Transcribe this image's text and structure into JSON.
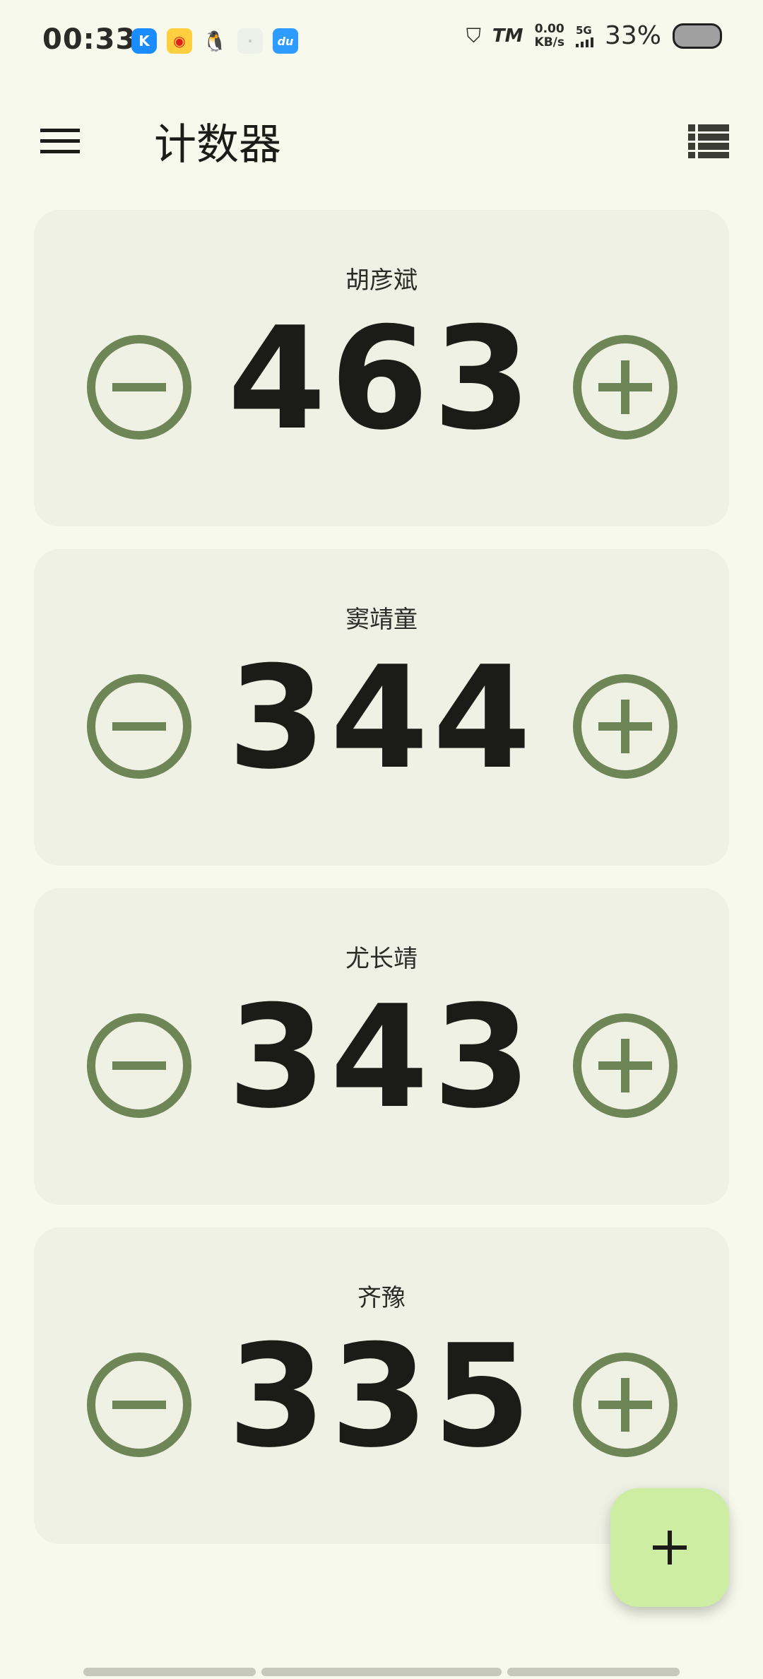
{
  "status_bar": {
    "time": "00:33",
    "notifications": [
      "kugou-icon",
      "weibo-icon",
      "qq-icon",
      "blank-icon",
      "du-icon"
    ],
    "kugou_glyph": "K",
    "du_glyph": "du",
    "net_speed_value": "0.00",
    "net_speed_unit": "KB/s",
    "network_type": "5G",
    "battery": "33%"
  },
  "app_bar": {
    "title": "计数器"
  },
  "counters": [
    {
      "name": "胡彦斌",
      "value": "463"
    },
    {
      "name": "窦靖童",
      "value": "344"
    },
    {
      "name": "尤长靖",
      "value": "343"
    },
    {
      "name": "齐豫",
      "value": "335"
    }
  ],
  "colors": {
    "background": "#f7f9ec",
    "card": "#eff1e5",
    "accent": "#6e8556",
    "fab": "#cdeda3",
    "text": "#1b1c17"
  }
}
